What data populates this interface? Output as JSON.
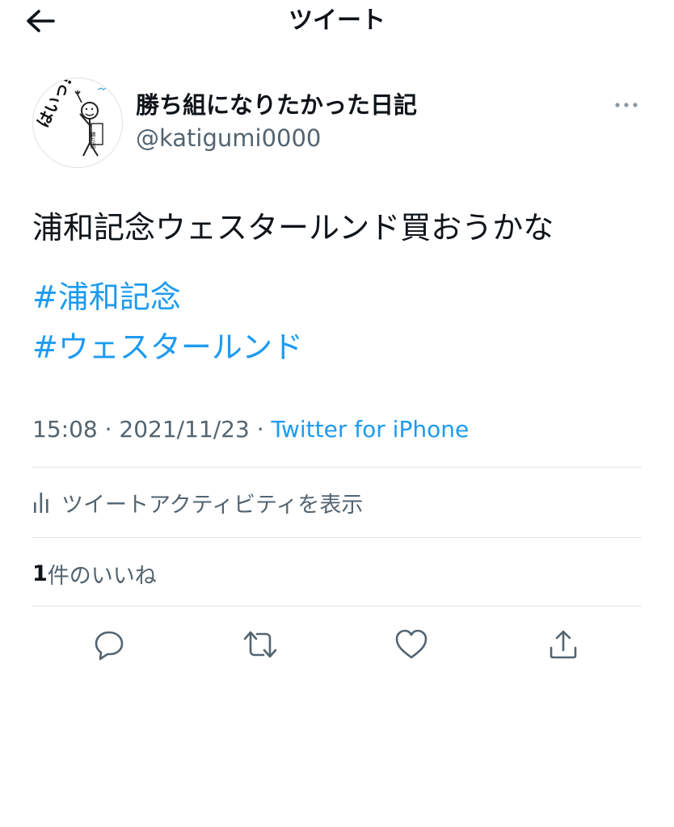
{
  "header": {
    "title": "ツイート",
    "back_icon": "arrow-left-icon"
  },
  "author": {
    "display_name": "勝ち組になりたかった日記",
    "handle": "@katigumi0000",
    "avatar_text": "はいっ!!",
    "avatar_sign": "勝ち組"
  },
  "tweet": {
    "text": "浦和記念ウェスタールンド買おうかな",
    "hashtags": [
      "#浦和記念",
      "#ウェスタールンド"
    ],
    "time": "15:08",
    "date": "2021/11/23",
    "separator": "·",
    "source": "Twitter for iPhone"
  },
  "activity": {
    "label": "ツイートアクティビティを表示",
    "icon": "bar-chart-icon"
  },
  "likes": {
    "count": "1",
    "label": "件のいいね"
  },
  "actions": {
    "reply_icon": "reply-icon",
    "retweet_icon": "retweet-icon",
    "like_icon": "heart-icon",
    "share_icon": "share-icon"
  },
  "colors": {
    "accent": "#1d9bf0",
    "secondary_text": "#536471",
    "primary_text": "#0f1419",
    "divider": "#e3e3e3"
  }
}
